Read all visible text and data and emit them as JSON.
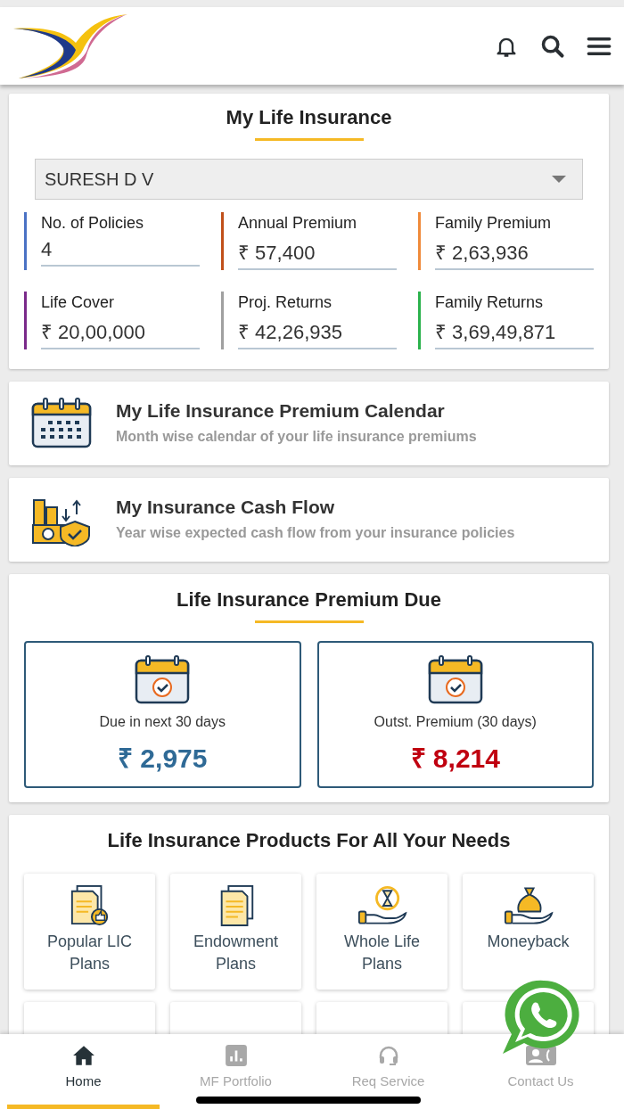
{
  "summary": {
    "title": "My Life Insurance",
    "member_select": {
      "value": "SURESH D V"
    },
    "stats": [
      {
        "label": "No. of Policies",
        "value": "4",
        "color": "#4a72c4"
      },
      {
        "label": "Annual Premium",
        "value": "₹ 57,400",
        "color": "#c0501a"
      },
      {
        "label": "Family Premium",
        "value": "₹ 2,63,936",
        "color": "#f08a3a"
      },
      {
        "label": "Life Cover",
        "value": "₹ 20,00,000",
        "color": "#7a2a8a"
      },
      {
        "label": "Proj. Returns",
        "value": "₹ 42,26,935",
        "color": "#a0a0a0"
      },
      {
        "label": "Family Returns",
        "value": "₹ 3,69,49,871",
        "color": "#2bb24c"
      }
    ]
  },
  "links": [
    {
      "kind": "calendar",
      "title": "My Life Insurance Premium Calendar",
      "subtitle": "Month wise calendar of your life insurance premiums"
    },
    {
      "kind": "cashflow",
      "title": "My Insurance Cash Flow",
      "subtitle": "Year wise expected cash flow from your insurance policies"
    }
  ],
  "premium_due": {
    "title": "Life Insurance Premium Due",
    "boxes": [
      {
        "label": "Due in next 30 days",
        "amount": "₹ 2,975",
        "color": "#2f6a96"
      },
      {
        "label": "Outst. Premium (30 days)",
        "amount": "₹ 8,214",
        "color": "#c00010"
      }
    ]
  },
  "products": {
    "title": "Life Insurance Products For All Your Needs",
    "items": [
      {
        "kind": "docs-badge",
        "label": "Popular LIC Plans"
      },
      {
        "kind": "docs",
        "label": "Endowment Plans"
      },
      {
        "kind": "hourglass-hand",
        "label": "Whole Life Plans"
      },
      {
        "kind": "moneybag-hand",
        "label": "Moneyback"
      }
    ]
  },
  "bottom_nav": [
    {
      "kind": "home",
      "label": "Home",
      "selected": true
    },
    {
      "kind": "chart",
      "label": "MF Portfolio",
      "selected": false
    },
    {
      "kind": "headset",
      "label": "Req Service",
      "selected": false
    },
    {
      "kind": "contact",
      "label": "Contact Us",
      "selected": false
    }
  ]
}
